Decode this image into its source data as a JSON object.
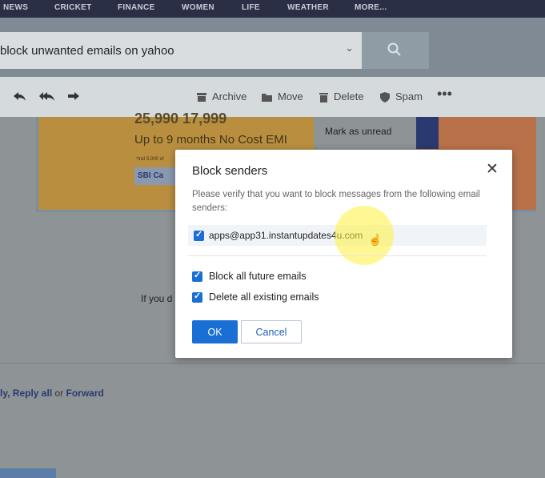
{
  "topnav": [
    "NEWS",
    "CRICKET",
    "FINANCE",
    "WOMEN",
    "LIFE",
    "WEATHER",
    "MORE..."
  ],
  "search": {
    "value": "block unwanted emails on yahoo"
  },
  "toolbar": {
    "archive": "Archive",
    "move": "Move",
    "delete": "Delete",
    "spam": "Spam"
  },
  "ad": {
    "price": "25,990 17,999",
    "headline": "Up to 9 months No Cost EMI",
    "fineprint": "*incl 5,000 of",
    "bank": "SBI Ca"
  },
  "context_menu": {
    "mark_unread": "Mark as unread"
  },
  "message": {
    "partial_text": "If you d",
    "reply_label": "ly, ",
    "reply_all": "Reply all",
    "or": " or ",
    "forward": "Forward"
  },
  "modal": {
    "title": "Block senders",
    "description": "Please verify that you want to block messages from the following email senders:",
    "sender": "apps@app31.instantupdates4u.com",
    "opt_block_future": "Block all future emails",
    "opt_delete_existing": "Delete all existing emails",
    "ok": "OK",
    "cancel": "Cancel"
  },
  "colors": {
    "accent": "#1a6fd4",
    "topnav": "#2b2f45"
  }
}
